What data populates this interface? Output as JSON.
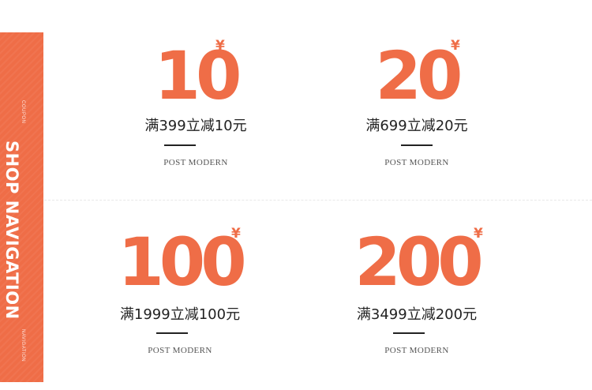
{
  "sidebar": {
    "title": "SHOP NAVIGATION",
    "top_caption": "COUPON",
    "bottom_caption": "NAVIGATION"
  },
  "currency_symbol": "¥",
  "brand_color": "#ef6d47",
  "coupons": [
    {
      "amount": "10",
      "description": "满399立减10元",
      "subtitle": "POST MODERN"
    },
    {
      "amount": "20",
      "description": "满699立减20元",
      "subtitle": "POST MODERN"
    },
    {
      "amount": "100",
      "description": "满1999立减100元",
      "subtitle": "POST MODERN"
    },
    {
      "amount": "200",
      "description": "满3499立减200元",
      "subtitle": "POST MODERN"
    }
  ]
}
